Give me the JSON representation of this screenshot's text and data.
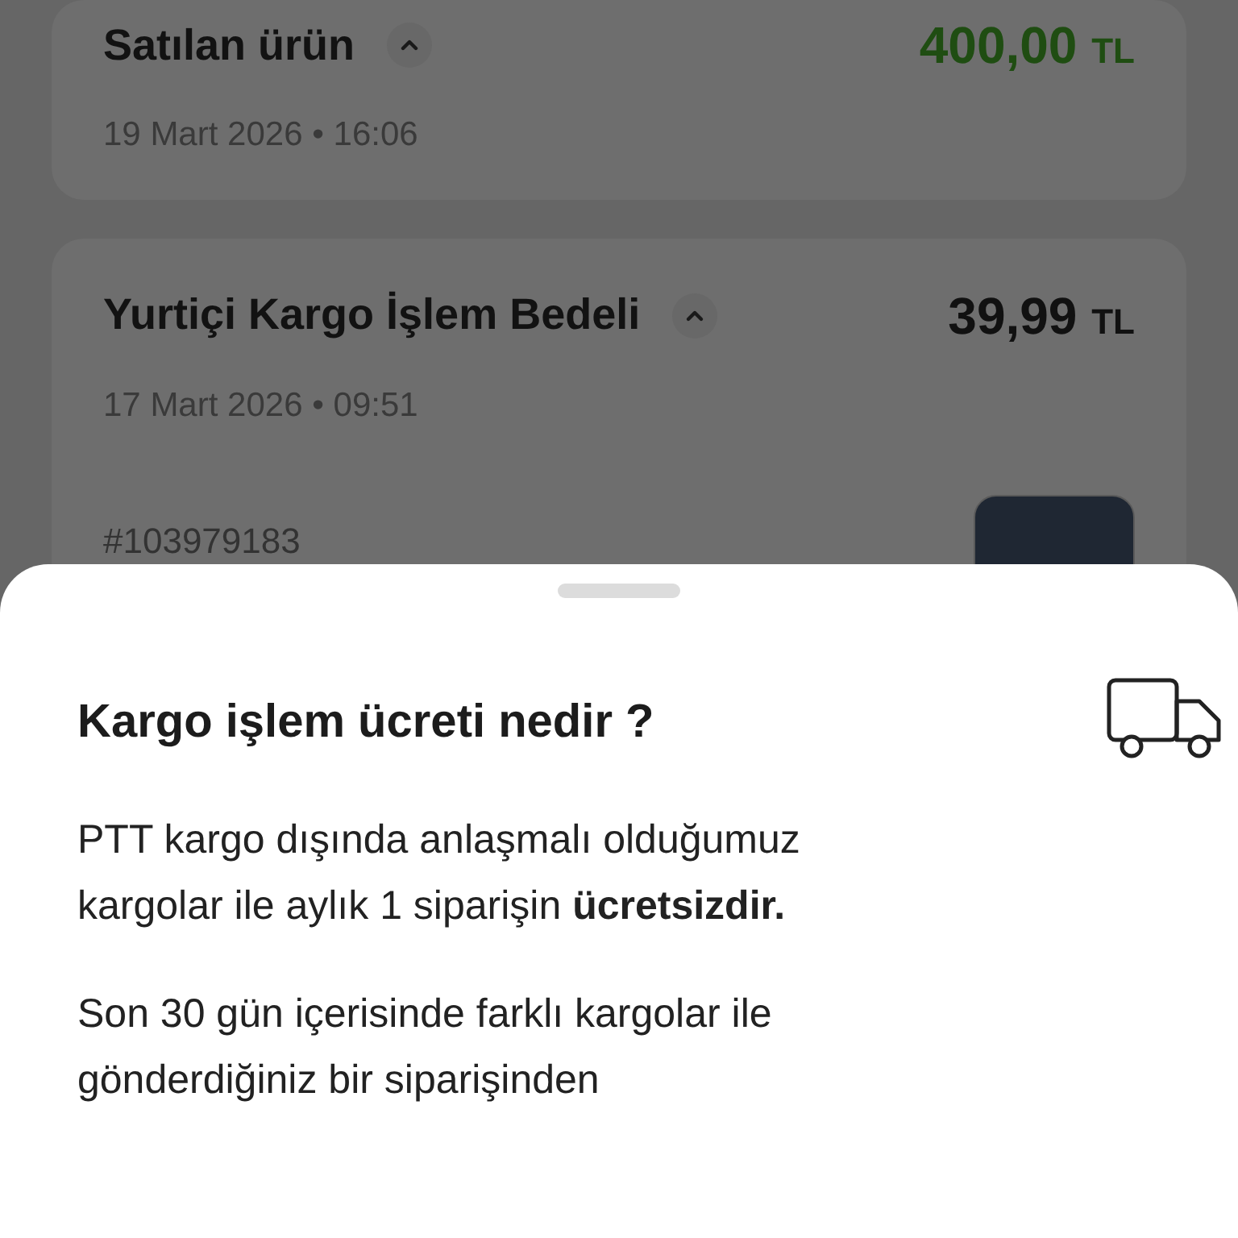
{
  "transactions": [
    {
      "title": "Satılan ürün",
      "amount": "400,00",
      "currency": "TL",
      "date": "19 Mart 2026 • 16:06",
      "kind": "income"
    },
    {
      "title": "Yurtiçi Kargo İşlem Bedeli",
      "amount": "39,99",
      "currency": "TL",
      "date": "17 Mart 2026 • 09:51",
      "kind": "expense",
      "order": "#103979183"
    }
  ],
  "sheet": {
    "title": "Kargo işlem ücreti nedir ?",
    "paragraphs": [
      "PTT kargo dışında anlaşmalı olduğumuz kargolar ile aylık 1 siparişin **ücretsizdir.**",
      "Son 30 gün içerisinde farklı kargolar ile gönderdiğiniz bir siparişinden"
    ]
  }
}
